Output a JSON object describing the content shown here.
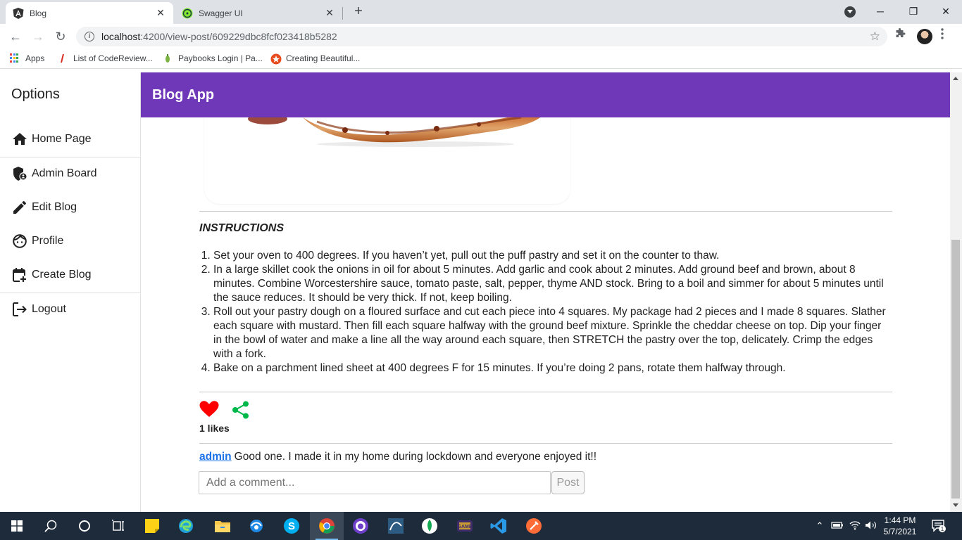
{
  "browser": {
    "tabs": [
      {
        "title": "Blog",
        "active": true,
        "icon": "angular-icon"
      },
      {
        "title": "Swagger UI",
        "active": false,
        "icon": "swagger-icon"
      }
    ],
    "url_host": "localhost",
    "url_path": ":4200/view-post/609229dbc8fcf023418b5282",
    "bookmarks": [
      {
        "label": "Apps",
        "icon": "apps-grid-icon"
      },
      {
        "label": "List of CodeReview...",
        "icon": "codereview-icon"
      },
      {
        "label": "Paybooks Login | Pa...",
        "icon": "paybooks-icon"
      },
      {
        "label": "Creating Beautiful...",
        "icon": "creating-beautiful-icon"
      }
    ]
  },
  "sidenav": {
    "title": "Options",
    "items": [
      {
        "label": "Home Page",
        "icon": "home-icon"
      },
      {
        "label": "Admin Board",
        "icon": "admin-shield-icon"
      },
      {
        "label": "Edit Blog",
        "icon": "pencil-icon"
      },
      {
        "label": "Profile",
        "icon": "face-icon"
      },
      {
        "label": "Create Blog",
        "icon": "calendar-add-icon"
      },
      {
        "label": "Logout",
        "icon": "logout-icon"
      }
    ]
  },
  "header": {
    "title": "Blog App"
  },
  "post": {
    "instructions_title": "INSTRUCTIONS",
    "steps": [
      "Set your oven to 400 degrees. If you haven’t yet, pull out the puff pastry and set it on the counter to thaw.",
      "In a large skillet cook the onions in oil for about 5 minutes. Add garlic and cook about 2 minutes. Add ground beef and brown, about 8 minutes. Combine Worcestershire sauce, tomato paste, salt, pepper, thyme AND stock. Bring to a boil and simmer for about 5 minutes until the sauce reduces. It should be very thick. If not, keep boiling.",
      "Roll out your pastry dough on a floured surface and cut each piece into 4 squares. My package had 2 pieces and I made 8 squares. Slather each square with mustard. Then fill each square halfway with the ground beef mixture. Sprinkle the cheddar cheese on top. Dip your finger in the bowl of water and make a line all the way around each square, then STRETCH the pastry over the top, delicately. Crimp the edges with a fork.",
      "Bake on a parchment lined sheet at 400 degrees F for 15 minutes. If you’re doing 2 pans, rotate them halfway through."
    ],
    "likes_text": "1 likes",
    "comments": [
      {
        "author": "admin",
        "text": "Good one. I made it in my home during lockdown and everyone enjoyed it!!"
      }
    ],
    "comment_placeholder": "Add a comment...",
    "post_button_label": "Post"
  },
  "taskbar": {
    "time": "1:44 PM",
    "date": "5/7/2021",
    "notification_count": "1"
  },
  "colors": {
    "header_bg": "#6f38b8",
    "heart": "#ff0000",
    "share": "#00b84a",
    "link": "#1a73e8"
  }
}
